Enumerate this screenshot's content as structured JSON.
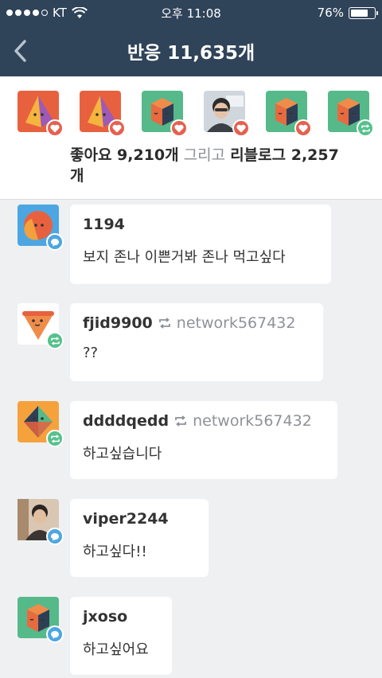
{
  "status": {
    "carrier": "KT",
    "time": "오후 11:08",
    "battery": "76%",
    "battery_level": 0.76
  },
  "nav": {
    "title": "반응 11,635개"
  },
  "reactions": {
    "avatars": [
      {
        "kind": "pyramid",
        "badge": "like"
      },
      {
        "kind": "pyramid",
        "badge": "like"
      },
      {
        "kind": "cube",
        "badge": "like"
      },
      {
        "kind": "photo-man",
        "badge": "like"
      },
      {
        "kind": "cube",
        "badge": "like"
      },
      {
        "kind": "cube",
        "badge": "reblog"
      }
    ],
    "likes_label": "좋아요 9,210개",
    "and_label": "그리고",
    "reblogs_label": "리블로그 2,257",
    "reblogs_suffix": "개"
  },
  "comments": [
    {
      "user": "1194",
      "via": "",
      "text": "보지 존나 이쁜거봐 존나 먹고싶다",
      "avatar": "face-circle",
      "badge": "reply"
    },
    {
      "user": "fjid9900",
      "via": "network567432",
      "text": "??",
      "avatar": "pizza",
      "badge": "reblog"
    },
    {
      "user": "ddddqedd",
      "via": "network567432",
      "text": "하고싶습니다",
      "avatar": "diamond",
      "badge": "reblog"
    },
    {
      "user": "viper2244",
      "via": "",
      "text": "하고싶다!!",
      "avatar": "photo-man2",
      "badge": "reply"
    },
    {
      "user": "jxoso",
      "via": "",
      "text": "하고싶어요",
      "avatar": "cube",
      "badge": "reply"
    }
  ],
  "colors": {
    "nav_bg": "#2f4359",
    "like": "#e5604f",
    "reblog": "#57c18b",
    "reply": "#4da6e1"
  }
}
